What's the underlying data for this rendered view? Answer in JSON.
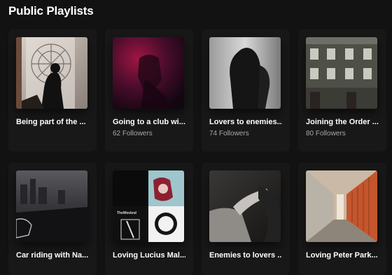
{
  "section": {
    "title": "Public Playlists"
  },
  "playlists": [
    {
      "title": "Being part of the ...",
      "followers": ""
    },
    {
      "title": "Going to a club wi...",
      "followers": "62 Followers"
    },
    {
      "title": "Lovers to enemies...",
      "followers": "74 Followers"
    },
    {
      "title": "Joining the Order ...",
      "followers": "80 Followers"
    },
    {
      "title": "Car riding with Na...",
      "followers": ""
    },
    {
      "title": "Loving Lucius Mal...",
      "followers": ""
    },
    {
      "title": "Enemies to lovers ...",
      "followers": ""
    },
    {
      "title": "Loving Peter Park...",
      "followers": ""
    }
  ],
  "collage_text": {
    "label": "TheWeeknd"
  }
}
